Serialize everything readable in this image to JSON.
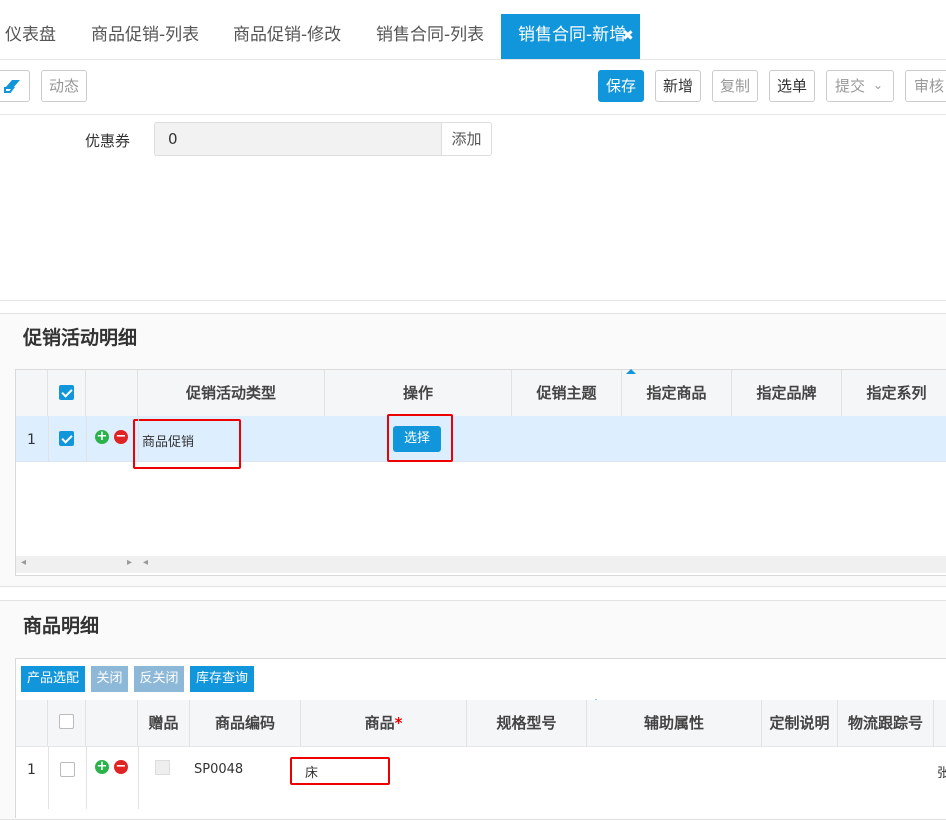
{
  "tabs": [
    {
      "label": "仪表盘"
    },
    {
      "label": "商品促销-列表"
    },
    {
      "label": "商品促销-修改"
    },
    {
      "label": "销售合同-列表"
    },
    {
      "label": "销售合同-新增"
    }
  ],
  "toolbar": {
    "dynamic_label": "动态",
    "save_label": "保存",
    "new_label": "新增",
    "copy_label": "复制",
    "select_label": "选单",
    "submit_label": "提交",
    "audit_label": "审核"
  },
  "coupon": {
    "label": "优惠券",
    "value": "0",
    "add_label": "添加"
  },
  "promo_section": {
    "title": "促销活动明细",
    "columns": [
      "促销活动类型",
      "操作",
      "促销主题",
      "指定商品",
      "指定品牌",
      "指定系列"
    ],
    "rows": [
      {
        "index": "1",
        "type": "商品促销",
        "action_label": "选择",
        "theme": "",
        "product": "",
        "brand": "",
        "series": ""
      }
    ]
  },
  "goods_section": {
    "title": "商品明细",
    "buttons": {
      "match": "产品选配",
      "close": "关闭",
      "reopen": "反关闭",
      "stock": "库存查询"
    },
    "columns": [
      "赠品",
      "商品编码",
      "商品",
      "规格型号",
      "辅助属性",
      "定制说明",
      "物流跟踪号"
    ],
    "required_mark": "*",
    "rows": [
      {
        "index": "1",
        "code": "SP0048",
        "product": "床",
        "trailing": "张"
      }
    ]
  },
  "colors": {
    "primary": "#1296db",
    "highlight_row": "#ddeeff",
    "annotation_red": "#e00000"
  }
}
